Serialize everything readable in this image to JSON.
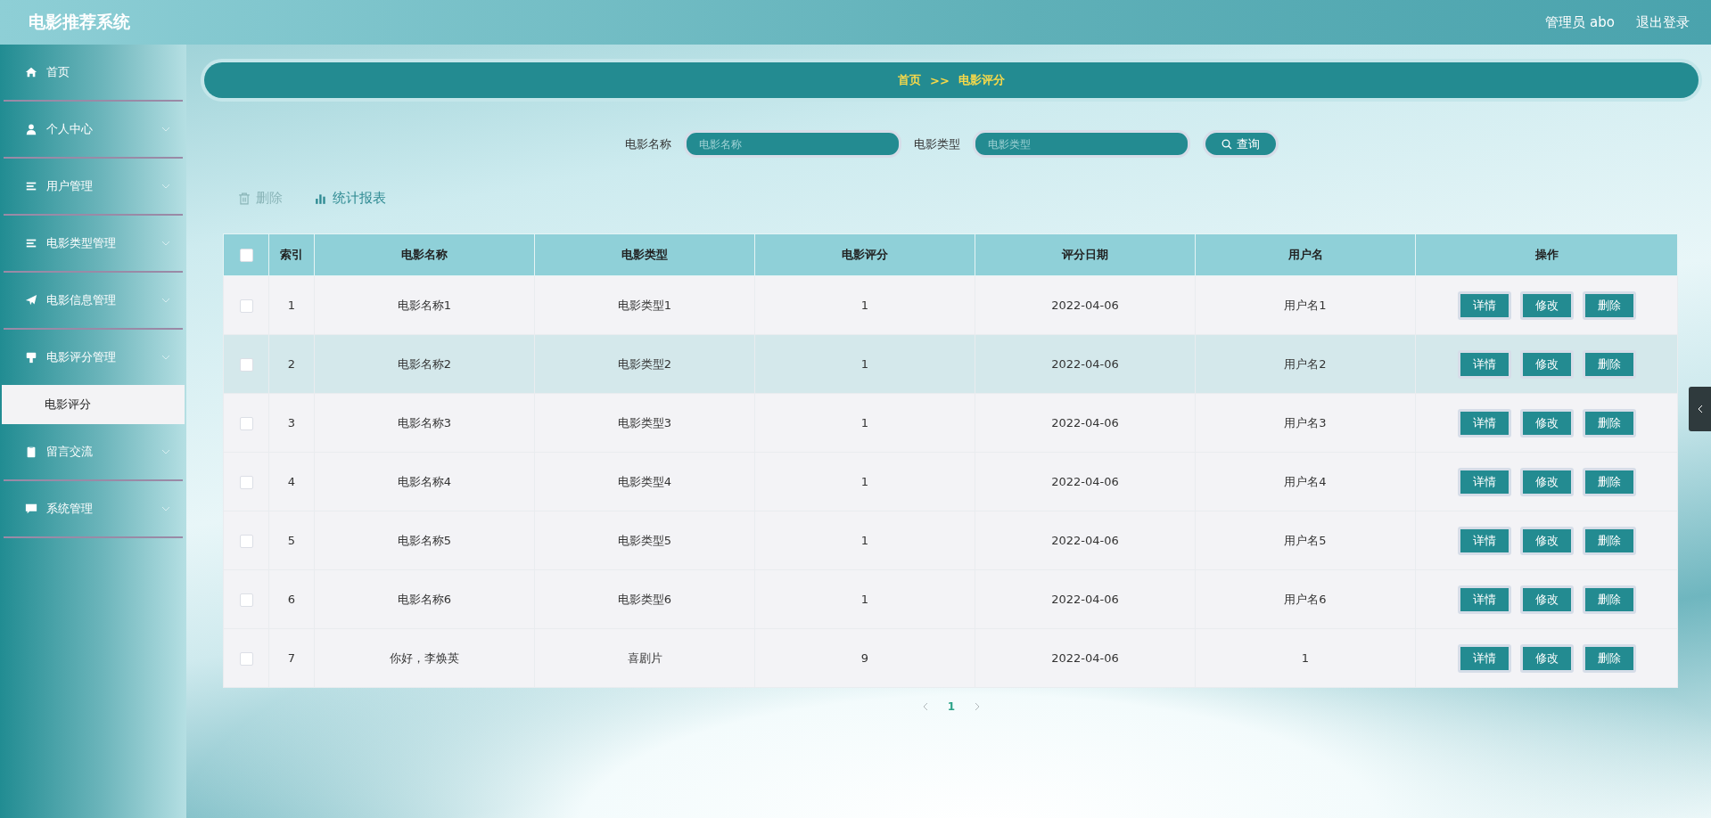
{
  "header": {
    "title": "电影推荐系统",
    "user": "管理员 abo",
    "logout": "退出登录"
  },
  "sidebar": {
    "items": [
      {
        "label": "首页",
        "kind": "link",
        "expanded": false
      },
      {
        "label": "个人中心",
        "kind": "menu",
        "expanded": false
      },
      {
        "label": "用户管理",
        "kind": "menu",
        "expanded": false
      },
      {
        "label": "电影类型管理",
        "kind": "menu",
        "expanded": false
      },
      {
        "label": "电影信息管理",
        "kind": "menu",
        "expanded": false
      },
      {
        "label": "电影评分管理",
        "kind": "menu",
        "expanded": true,
        "children": [
          {
            "label": "电影评分",
            "selected": true
          }
        ]
      },
      {
        "label": "留言交流",
        "kind": "menu",
        "expanded": false
      },
      {
        "label": "系统管理",
        "kind": "menu",
        "expanded": false
      }
    ]
  },
  "breadcrumb": {
    "home": "首页",
    "separator": ">>",
    "current": "电影评分"
  },
  "search": {
    "fields": [
      {
        "label": "电影名称",
        "placeholder": "电影名称"
      },
      {
        "label": "电影类型",
        "placeholder": "电影类型"
      }
    ],
    "button": "查询"
  },
  "actions": {
    "delete": "删除",
    "report": "统计报表"
  },
  "table": {
    "select_all": {
      "checked": false
    },
    "columns": [
      "索引",
      "电影名称",
      "电影类型",
      "电影评分",
      "评分日期",
      "用户名",
      "操作"
    ],
    "rows": [
      {
        "checked": false,
        "highlighted": false,
        "cells": [
          "1",
          "电影名称1",
          "电影类型1",
          "1",
          "2022-04-06",
          "用户名1"
        ],
        "buttons": [
          "详情",
          "修改",
          "删除"
        ]
      },
      {
        "checked": false,
        "highlighted": true,
        "cells": [
          "2",
          "电影名称2",
          "电影类型2",
          "1",
          "2022-04-06",
          "用户名2"
        ],
        "buttons": [
          "详情",
          "修改",
          "删除"
        ]
      },
      {
        "checked": false,
        "highlighted": false,
        "cells": [
          "3",
          "电影名称3",
          "电影类型3",
          "1",
          "2022-04-06",
          "用户名3"
        ],
        "buttons": [
          "详情",
          "修改",
          "删除"
        ]
      },
      {
        "checked": false,
        "highlighted": false,
        "cells": [
          "4",
          "电影名称4",
          "电影类型4",
          "1",
          "2022-04-06",
          "用户名4"
        ],
        "buttons": [
          "详情",
          "修改",
          "删除"
        ]
      },
      {
        "checked": false,
        "highlighted": false,
        "cells": [
          "5",
          "电影名称5",
          "电影类型5",
          "1",
          "2022-04-06",
          "用户名5"
        ],
        "buttons": [
          "详情",
          "修改",
          "删除"
        ]
      },
      {
        "checked": false,
        "highlighted": false,
        "cells": [
          "6",
          "电影名称6",
          "电影类型6",
          "1",
          "2022-04-06",
          "用户名6"
        ],
        "buttons": [
          "详情",
          "修改",
          "删除"
        ]
      },
      {
        "checked": false,
        "highlighted": false,
        "cells": [
          "7",
          "你好，李焕英",
          "喜剧片",
          "9",
          "2022-04-06",
          "1"
        ],
        "buttons": [
          "详情",
          "修改",
          "删除"
        ]
      }
    ]
  },
  "pagination": {
    "pages": [
      {
        "label": "1",
        "selected": true
      }
    ]
  }
}
